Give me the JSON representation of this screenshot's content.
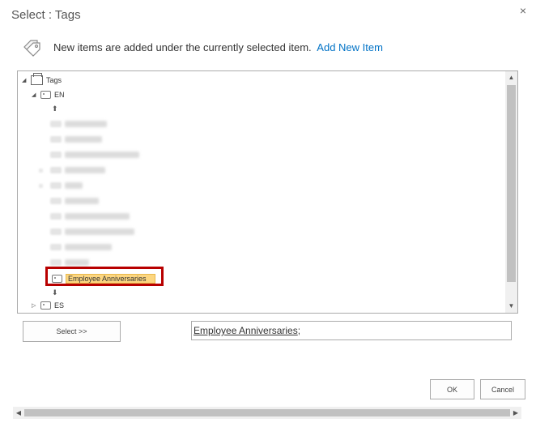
{
  "dialog": {
    "title": "Select : Tags",
    "close_glyph": "×"
  },
  "info": {
    "icon": "tags-icon",
    "text": "New items are added under the currently selected item.",
    "link_label": "Add New Item"
  },
  "tree": {
    "root_label": "Tags",
    "en_label": "EN",
    "selected_label": "Employee Anniversaries",
    "es_label": "ES",
    "scroll_up_glyph": "▲",
    "scroll_down_glyph": "▼",
    "expanded_glyph": "◢",
    "collapsed_glyph": "▷",
    "move_up_glyph": "⬆",
    "move_down_glyph": "⬇"
  },
  "actions": {
    "select_label": "Select >>",
    "selected_value_term": "Employee Anniversaries",
    "selected_value_suffix": ";",
    "ok_label": "OK",
    "cancel_label": "Cancel"
  },
  "hscroll": {
    "left_glyph": "◀",
    "right_glyph": "▶"
  }
}
